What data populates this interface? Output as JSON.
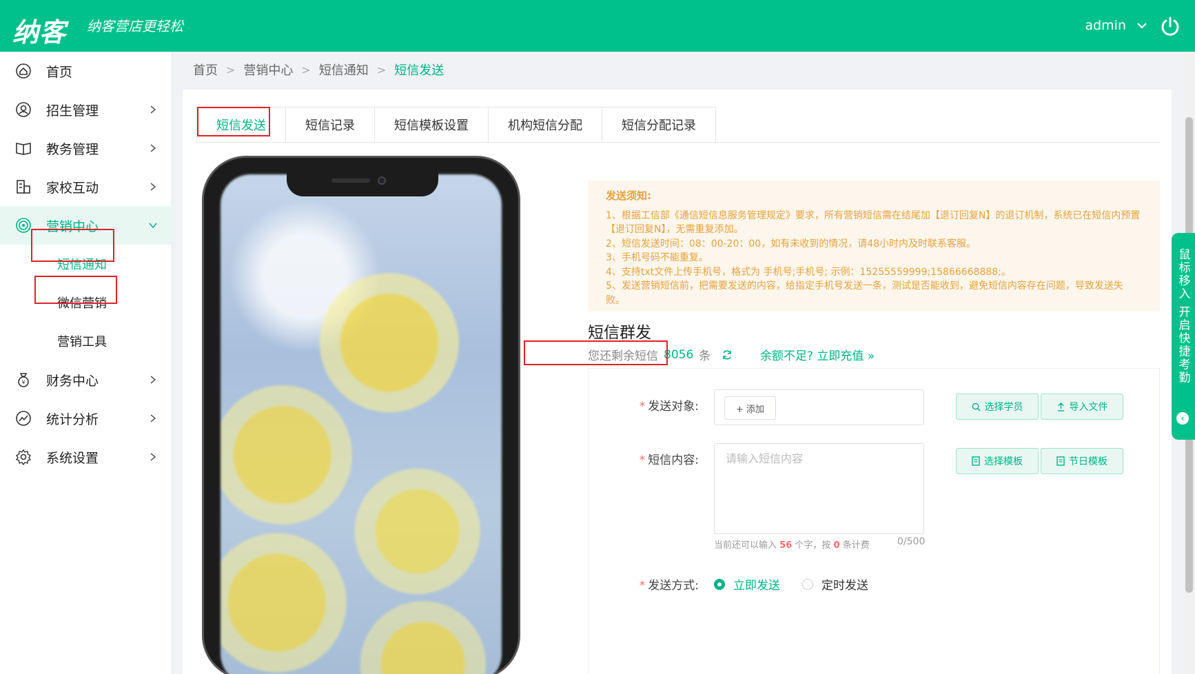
{
  "brand": {
    "logo": "纳客",
    "slogan": "纳客营店更轻松",
    "accent": "#00c08b"
  },
  "user": {
    "name": "admin"
  },
  "sidebar": {
    "items": [
      {
        "label": "首页",
        "icon": "home-icon"
      },
      {
        "label": "招生管理",
        "icon": "user-card-icon"
      },
      {
        "label": "教务管理",
        "icon": "book-icon"
      },
      {
        "label": "家校互动",
        "icon": "school-icon"
      },
      {
        "label": "营销中心",
        "icon": "target-icon"
      },
      {
        "label": "财务中心",
        "icon": "money-bag-icon"
      },
      {
        "label": "统计分析",
        "icon": "chart-icon"
      },
      {
        "label": "系统设置",
        "icon": "gear-icon"
      }
    ],
    "sub_items": [
      "短信通知",
      "微信营销",
      "营销工具"
    ]
  },
  "breadcrumb": [
    "首页",
    "营销中心",
    "短信通知",
    "短信发送"
  ],
  "tabs": [
    "短信发送",
    "短信记录",
    "短信模板设置",
    "机构短信分配",
    "短信分配记录"
  ],
  "notice": {
    "title": "发送须知:",
    "lines": [
      "1、根据工信部《通信短信息服务管理规定》要求，所有营销短信需在结尾加【退订回复N】的退订机制，系统已在短信内预置【退订回复N】，无需重复添加。",
      "2、短信发送时间：08：00-20：00，如有未收到的情况，请48小时内及时联系客服。",
      "3、手机号码不能重复。",
      "4、支持txt文件上传手机号，格式为 手机号;手机号; 示例：15255559999;15866668888;。",
      "5、发送营销短信前，把需要发送的内容，给指定手机号发送一条，测试是否能收到，避免短信内容存在问题，导致发送失败。"
    ]
  },
  "sms": {
    "section_title": "短信群发",
    "balance_prefix": "您还剩余短信",
    "balance_value": "8056",
    "balance_unit": "条",
    "recharge_text": "余额不足? 立即充值 »"
  },
  "form": {
    "target_label": "发送对象:",
    "add_button": "+ 添加",
    "select_student": "选择学员",
    "import_file": "导入文件",
    "content_label": "短信内容:",
    "content_placeholder": "请输入短信内容",
    "select_template": "选择模板",
    "holiday_template": "节日模板",
    "hint_prefix": "当前还可以输入",
    "hint_chars": "56",
    "hint_mid": "个字，按",
    "hint_count": "0",
    "hint_suffix": "条计费",
    "counter": "0/500",
    "send_mode_label": "发送方式:",
    "send_now": "立即发送",
    "send_scheduled": "定时发送"
  },
  "float_tab": {
    "text": "鼠标移入 开启快捷考勤"
  }
}
